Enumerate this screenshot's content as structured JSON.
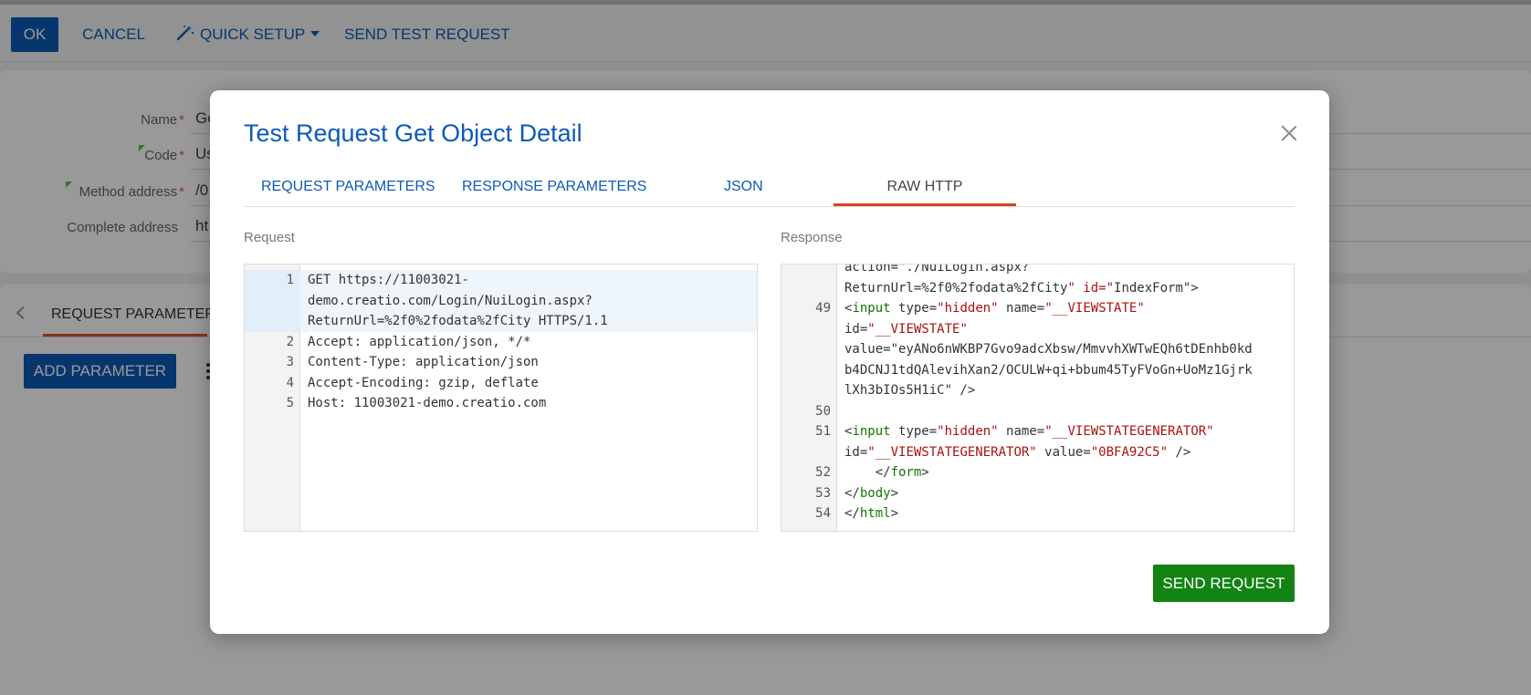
{
  "toolbar": {
    "ok_label": "OK",
    "cancel_label": "CANCEL",
    "quick_setup_label": "QUICK SETUP",
    "send_test_label": "SEND TEST REQUEST"
  },
  "form": {
    "name_label": "Name",
    "name_value": "Ge",
    "code_label": "Code",
    "code_value": "Us",
    "method_label": "Method address",
    "method_value": "/0",
    "complete_label": "Complete address",
    "complete_value": "ht",
    "required_mark": "*"
  },
  "lower_tabs": {
    "request_parameters": "REQUEST PARAMETERS",
    "add_parameter": "ADD PARAMETER"
  },
  "modal": {
    "title": "Test Request Get Object Detail",
    "tabs": [
      "REQUEST PARAMETERS",
      "RESPONSE PARAMETERS",
      "JSON",
      "RAW HTTP"
    ],
    "active_tab": "RAW HTTP",
    "request_label": "Request",
    "response_label": "Response",
    "send_request_label": "SEND REQUEST"
  },
  "request_lines": [
    {
      "num": "1",
      "text": "GET https://11003021-\ndemo.creatio.com/Login/NuiLogin.aspx?\nReturnUrl=%2f0%2fodata%2fCity HTTPS/1.1"
    },
    {
      "num": "2",
      "text": "Accept: application/json, */*"
    },
    {
      "num": "3",
      "text": "Content-Type: application/json"
    },
    {
      "num": "4",
      "text": "Accept-Encoding: gzip, deflate"
    },
    {
      "num": "5",
      "text": "Host: 11003021-demo.creatio.com"
    }
  ],
  "response_lines": [
    {
      "num": "",
      "text": "action=\"./NuiLogin.aspx?"
    },
    {
      "num": "",
      "text": "ReturnUrl=%2f0%2fodata%2fCity\" id=\"IndexForm\">"
    },
    {
      "num": "49",
      "text": "<input type=\"hidden\" name=\"__VIEWSTATE\""
    },
    {
      "num": "",
      "text": "id=\"__VIEWSTATE\""
    },
    {
      "num": "",
      "text": "value=\"eyANo6nWKBP7Gvo9adcXbsw/MmvvhXWTwEQh6tDEnhb0kd"
    },
    {
      "num": "",
      "text": "b4DCNJ1tdQAlevihXan2/OCULW+qi+bbum45TyFVoGn+UoMz1Gjrk"
    },
    {
      "num": "",
      "text": "lXh3bIOs5H1iC\" />"
    },
    {
      "num": "50",
      "text": ""
    },
    {
      "num": "51",
      "text": "<input type=\"hidden\" name=\"__VIEWSTATEGENERATOR\""
    },
    {
      "num": "",
      "text": "id=\"__VIEWSTATEGENERATOR\" value=\"0BFA92C5\" />"
    },
    {
      "num": "52",
      "text": "    </form>"
    },
    {
      "num": "53",
      "text": "</body>"
    },
    {
      "num": "54",
      "text": "</html>"
    }
  ],
  "colors": {
    "accent": "#0d5ab7",
    "active_tab_underline": "#d9441f",
    "send_button": "#138313",
    "code_tag": "#117700",
    "code_string": "#aa1111"
  }
}
